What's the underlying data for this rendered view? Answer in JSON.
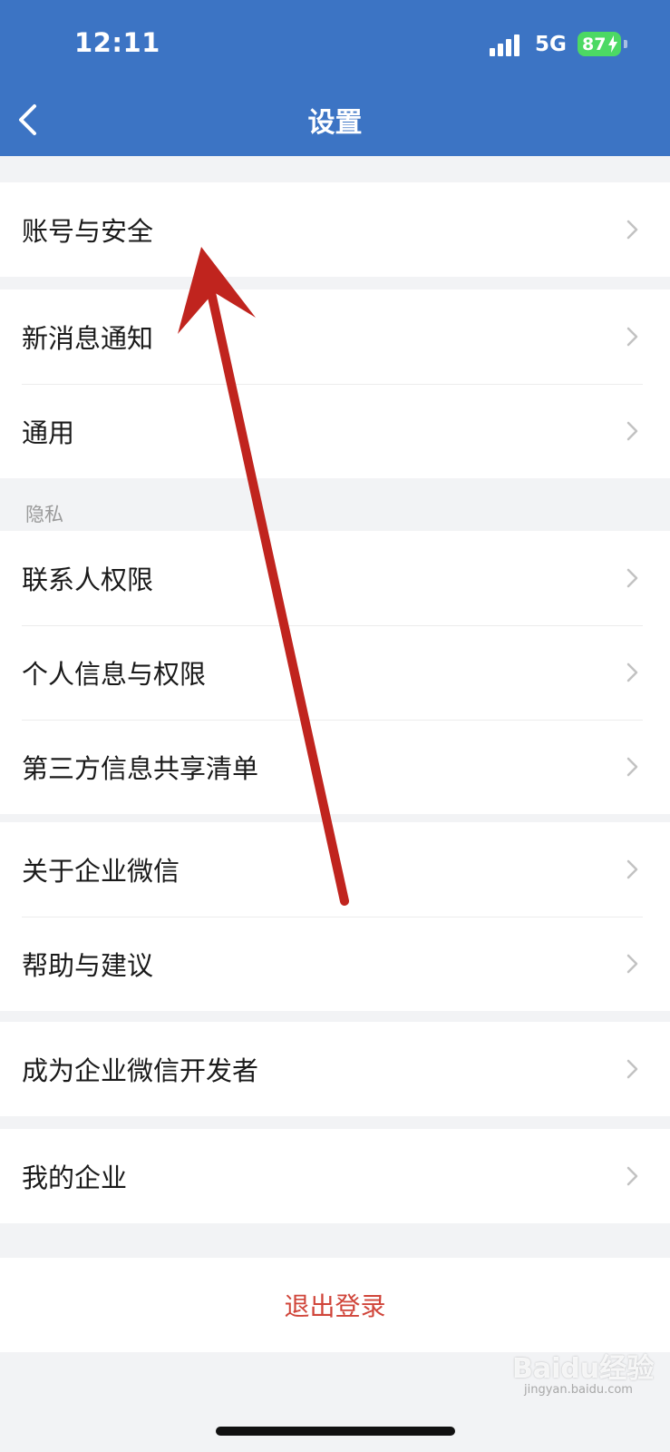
{
  "status_bar": {
    "time": "12:11",
    "network": "5G",
    "battery": "87"
  },
  "header": {
    "title": "设置",
    "back_icon": "chevron-left-icon"
  },
  "groups": [
    {
      "items": [
        {
          "label": "账号与安全"
        }
      ]
    },
    {
      "items": [
        {
          "label": "新消息通知"
        },
        {
          "label": "通用"
        }
      ]
    },
    {
      "section_label": "隐私",
      "items": [
        {
          "label": "联系人权限"
        },
        {
          "label": "个人信息与权限"
        },
        {
          "label": "第三方信息共享清单"
        }
      ]
    },
    {
      "items": [
        {
          "label": "关于企业微信"
        },
        {
          "label": "帮助与建议"
        }
      ]
    },
    {
      "items": [
        {
          "label": "成为企业微信开发者"
        }
      ]
    },
    {
      "items": [
        {
          "label": "我的企业"
        }
      ]
    }
  ],
  "logout": {
    "label": "退出登录"
  },
  "watermark": {
    "text": "Baidu经验",
    "sub": "jingyan.baidu.com"
  },
  "colors": {
    "header_bg": "#3c74c4",
    "page_bg": "#f2f3f5",
    "logout_text": "#d0453a",
    "annotation_arrow": "#c0241e",
    "battery": "#4cd964"
  }
}
